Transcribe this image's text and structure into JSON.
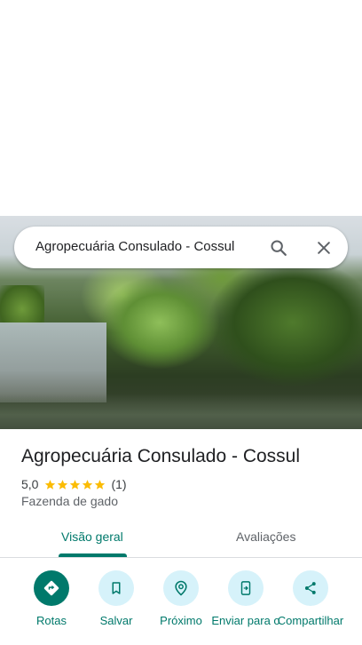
{
  "search": {
    "query": "Agropecuária Consulado - Cossul",
    "search_icon": "search-icon",
    "close_icon": "close-icon"
  },
  "place": {
    "name": "Agropecuária Consulado - Cossul",
    "rating": "5,0",
    "stars": 5,
    "review_count": "(1)",
    "category": "Fazenda de gado"
  },
  "tabs": [
    {
      "label": "Visão geral",
      "active": true
    },
    {
      "label": "Avaliações",
      "active": false
    }
  ],
  "actions": [
    {
      "label": "Rotas",
      "icon": "directions-icon"
    },
    {
      "label": "Salvar",
      "icon": "bookmark-icon"
    },
    {
      "label": "Próximo",
      "icon": "nearby-icon"
    },
    {
      "label": "Enviar para o",
      "icon": "send-to-phone-icon"
    },
    {
      "label": "Compartilhar",
      "icon": "share-icon"
    }
  ],
  "colors": {
    "accent": "#00796b",
    "action_bg": "#d6f2fa",
    "star": "#fbbc04"
  }
}
